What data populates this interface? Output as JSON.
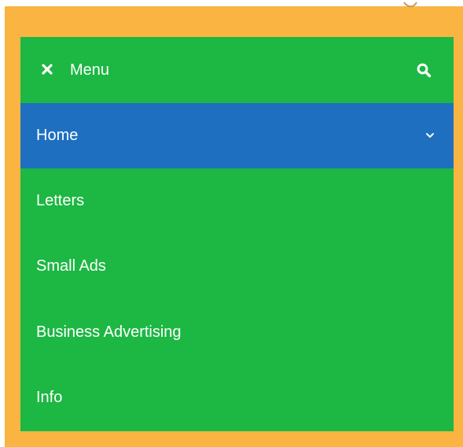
{
  "colors": {
    "frame": "#f9b442",
    "panel": "#1db743",
    "active_item": "#1e6fc0",
    "text": "#ffffff"
  },
  "header": {
    "close_icon": "close-icon",
    "title": "Menu",
    "search_icon": "search-icon"
  },
  "menu": {
    "items": [
      {
        "label": "Home",
        "active": true,
        "has_submenu": true
      },
      {
        "label": "Letters",
        "active": false,
        "has_submenu": false
      },
      {
        "label": "Small Ads",
        "active": false,
        "has_submenu": false
      },
      {
        "label": "Business Advertising",
        "active": false,
        "has_submenu": false
      },
      {
        "label": "Info",
        "active": false,
        "has_submenu": false
      }
    ]
  }
}
